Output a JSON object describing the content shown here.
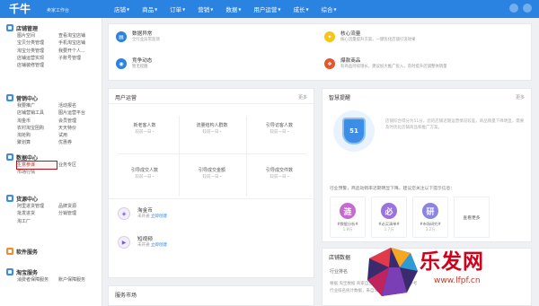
{
  "topbar": {
    "logo": "千牛",
    "logo_sub": "卖家工作台",
    "nav": [
      {
        "label": "店铺"
      },
      {
        "label": "商品"
      },
      {
        "label": "订单"
      },
      {
        "label": "营销"
      },
      {
        "label": "数据"
      },
      {
        "label": "用户运营"
      },
      {
        "label": "成长"
      },
      {
        "label": "综合"
      }
    ]
  },
  "sidebar": {
    "sections": [
      {
        "title": "店铺管理",
        "color": "#3b8de6",
        "links": [
          "图片空间",
          "查看淘宝店铺",
          "宝贝分类管理",
          "手机淘宝店铺",
          "淘宝分类管理",
          "我要开个人...",
          "店铺运营实现",
          "子账号管理",
          "店铺装修管理",
          ""
        ]
      },
      {
        "title": "营销中心",
        "color": "#3b8de6",
        "links": [
          "我要推广",
          "活动报名",
          "店铺营销工具",
          "图片运营平台",
          "淘金币",
          "会员管理",
          "农村淘宝团购",
          "天天特价",
          "淘抢购",
          "试用",
          "聚划算",
          "优惠券"
        ]
      },
      {
        "title": "数据中心",
        "color": "#3b8de6",
        "links": [
          "生意参谋",
          "业务专区",
          "市场行情",
          ""
        ]
      },
      {
        "title": "货源中心",
        "color": "#3b8de6",
        "links": [
          "阿里进货管理",
          "品牌货源",
          "批发进货",
          "分销管理",
          "淘工厂",
          ""
        ]
      },
      {
        "title": "软件服务",
        "color": "#f08c2e",
        "links": []
      },
      {
        "title": "淘宝服务",
        "color": "#3b8de6",
        "links": [
          "消费者保障服务",
          "账户保障服务"
        ]
      }
    ]
  },
  "alerts": [
    {
      "title": "数据异常",
      "sub": "全行业异常监测",
      "color": "#2a83e0",
      "icon": "chart-icon"
    },
    {
      "title": "核心流量",
      "sub": "核心流量提升方案，一键优化店铺引流效果",
      "color": "#f5c518",
      "icon": "bulb-icon"
    },
    {
      "title": "竞争动态",
      "sub": "暂无提醒",
      "color": "#2a83e0",
      "icon": "speaker-icon"
    },
    {
      "title": "爆款商品",
      "sub": "有商品持续增长，建议加大推广投入，及时提升店铺整体销量",
      "color": "#e8542e",
      "icon": "gift-icon"
    }
  ],
  "user_ops": {
    "title": "用户运营",
    "more": "更多",
    "metrics": [
      {
        "name": "新老客人数",
        "period": "较前一日",
        "value": "-"
      },
      {
        "name": "流量结构人群数",
        "period": "较前一日",
        "value": "-"
      },
      {
        "name": "引导访客人数",
        "period": "较前一日",
        "value": "-"
      },
      {
        "name": "引导成交人数",
        "period": "较前一日",
        "value": "-"
      },
      {
        "name": "引导成交金额",
        "period": "较前一日",
        "value": "-"
      },
      {
        "name": "引导成交件数",
        "period": "较前一日",
        "value": "-"
      }
    ],
    "tools": [
      {
        "title": "淘金币",
        "sub": "未开通",
        "link": "立即创建"
      },
      {
        "title": "短视频",
        "sub": "未开通",
        "link": "立即创建"
      }
    ]
  },
  "service_market": {
    "title": "服务市场"
  },
  "diagnosis": {
    "title": "智慧提醒",
    "more": "更多",
    "score": "51",
    "text": "店铺综合得分为51分，您的店铺近期运营情况较差，商品销量下降明显，需要及时优化店铺商品和推广方案。",
    "warn": "行业预警，商品动销率近期明显下降，建议您关注以下提示信息：",
    "tips": [
      {
        "glyph": "涟",
        "caption": "#数据分析#",
        "num": "1.9万",
        "color": "#c66ad0"
      },
      {
        "glyph": "必",
        "caption": "#必买清单#",
        "num": "1.7万",
        "color": "#9a73dd"
      },
      {
        "glyph": "研",
        "caption": "#市场研究#",
        "num": "3.2万",
        "color": "#8b84e0"
      }
    ],
    "more_tips": "查看更多"
  },
  "shop_data": {
    "title": "店铺数据",
    "sub": "行业排名",
    "note1": "根据 淘宝数据 商家自主分析排行，数据仅供参考",
    "note2": "行业排名统计数据，来自淘宝网"
  },
  "watermark": {
    "text": "乐发网",
    "url": "www.lfpf.cn"
  }
}
